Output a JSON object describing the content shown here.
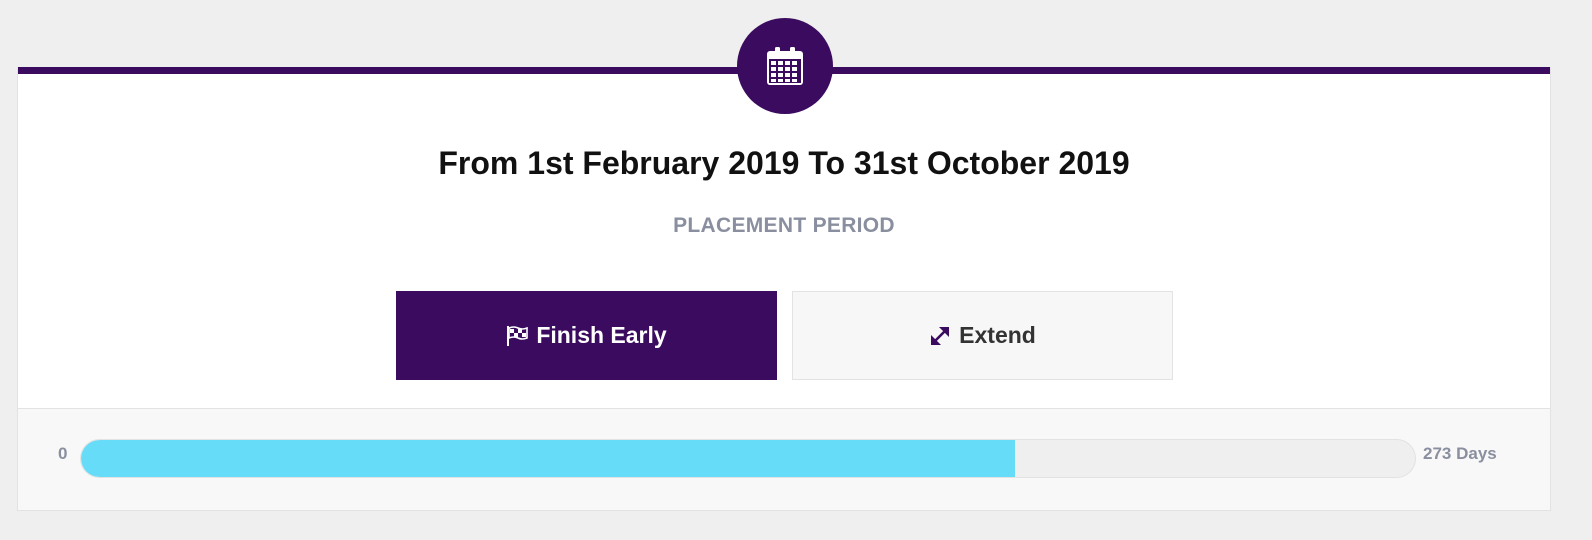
{
  "placement": {
    "title": "From 1st February 2019 To 31st October 2019",
    "subtitle": "PLACEMENT PERIOD",
    "icon": "calendar-icon"
  },
  "actions": {
    "finish_label": "Finish Early",
    "finish_icon": "checkered-flag-icon",
    "extend_label": "Extend",
    "extend_icon": "expand-arrows-icon"
  },
  "progress": {
    "min_label": "0",
    "max_label": "273 Days",
    "fraction": 0.7
  },
  "colors": {
    "brand": "#3a0b5e",
    "progress_fill": "#66dcf8",
    "muted_text": "#8a8f9f"
  }
}
